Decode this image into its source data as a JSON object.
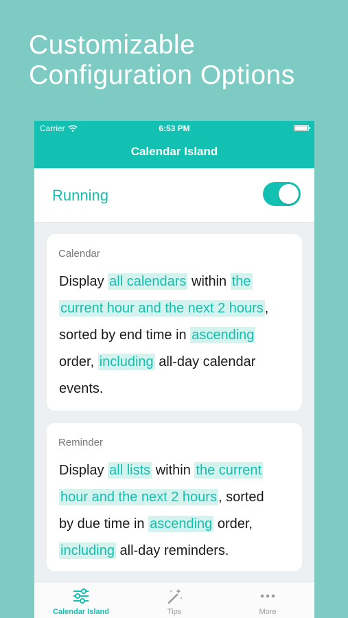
{
  "promo": {
    "line1": "Customizable",
    "line2": "Configuration Options"
  },
  "status_bar": {
    "carrier": "Carrier",
    "time": "6:53 PM"
  },
  "nav": {
    "title": "Calendar Island"
  },
  "running": {
    "label": "Running",
    "enabled": true
  },
  "calendar_card": {
    "label": "Calendar",
    "lines": [
      [
        "Display ",
        "all calendars",
        " within ",
        "the"
      ],
      [
        "current hour and the next 2 hours",
        ","
      ],
      [
        "sorted by end time in ",
        "ascending"
      ],
      [
        "order, ",
        "including",
        " all-day calendar"
      ],
      [
        "events."
      ]
    ]
  },
  "reminder_card": {
    "label": "Reminder",
    "lines": [
      [
        "Display ",
        "all lists",
        " within ",
        "the current"
      ],
      [
        "hour and the next 2 hours",
        ", sorted"
      ],
      [
        "by due time in ",
        "ascending",
        " order,"
      ],
      [
        "including",
        " all-day reminders."
      ]
    ]
  },
  "tab_bar": {
    "tabs": [
      {
        "label": "Calendar Island",
        "icon": "sliders-icon",
        "active": true
      },
      {
        "label": "Tips",
        "icon": "magic-wand-icon",
        "active": false
      },
      {
        "label": "More",
        "icon": "ellipsis-icon",
        "active": false
      }
    ]
  },
  "colors": {
    "background": "#7ecbc4",
    "accent": "#12c1b2",
    "highlight_bg": "#d4f3ef"
  }
}
